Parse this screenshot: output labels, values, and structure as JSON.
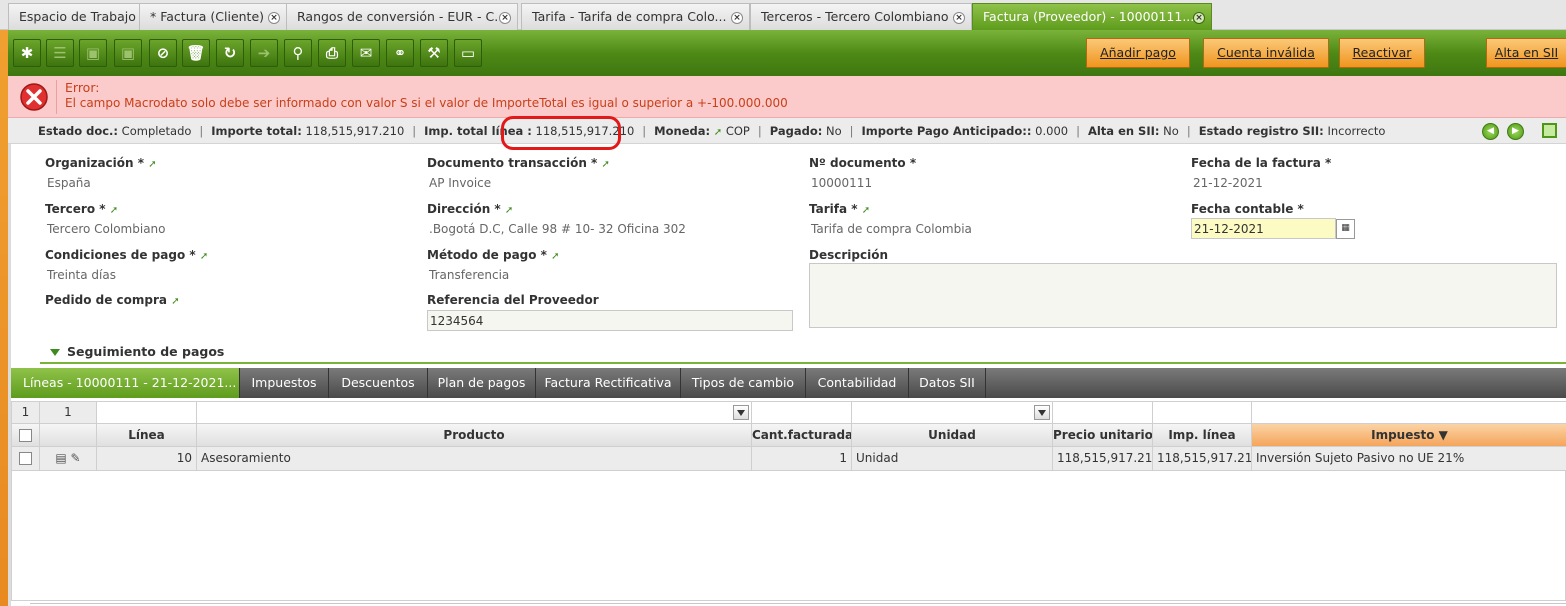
{
  "window_tabs": [
    {
      "label": "Espacio de Trabajo"
    },
    {
      "label": "* Factura (Cliente)"
    },
    {
      "label": "Rangos de conversión - EUR - C..."
    },
    {
      "label": "Tarifa - Tarifa de compra Colo..."
    },
    {
      "label": "Terceros - Tercero Colombiano"
    },
    {
      "label": "Factura (Proveedor) - 10000111..."
    }
  ],
  "toolbar": {
    "icons": [
      "new-document-icon",
      "grid-view-icon",
      "save-icon",
      "save-close-icon",
      "undo-icon",
      "delete-icon",
      "refresh-icon",
      "export-icon",
      "attachment-icon",
      "print-icon",
      "email-icon",
      "link-icon",
      "tools-icon",
      "form-view-icon"
    ],
    "buttons": {
      "add_payment": "Añadir pago",
      "invalid_account": "Cuenta inválida",
      "reactivate": "Reactivar",
      "sii_register": "Alta en SII"
    }
  },
  "error": {
    "title": "Error:",
    "message": "El campo Macrodato solo debe ser informado con valor S si el valor de ImporteTotal es igual o superior a +-100.000.000"
  },
  "status": {
    "doc_status_label": "Estado doc.:",
    "doc_status_value": "Completado",
    "total_label": "Importe total:",
    "total_value": "118,515,917.210",
    "line_total_label": "Imp. total línea :",
    "line_total_value": "118,515,917.210",
    "currency_label": "Moneda:",
    "currency_value": "COP",
    "paid_label": "Pagado:",
    "paid_value": "No",
    "prepayment_label": "Importe Pago Anticipado::",
    "prepayment_value": "0.000",
    "sii_label": "Alta en SII:",
    "sii_value": "No",
    "sii_status_label": "Estado registro SII:",
    "sii_status_value": "Incorrecto",
    "sep": "|"
  },
  "form": {
    "organization_label": "Organización *",
    "organization_value": "España",
    "doc_transaction_label": "Documento transacción *",
    "doc_transaction_value": "AP Invoice",
    "doc_number_label": "Nº documento *",
    "doc_number_value": "10000111",
    "invoice_date_label": "Fecha de la factura *",
    "invoice_date_value": "21-12-2021",
    "third_party_label": "Tercero *",
    "third_party_value": "Tercero Colombiano",
    "address_label": "Dirección *",
    "address_value": ".Bogotá D.C, Calle 98 # 10- 32 Oficina 302",
    "pricelist_label": "Tarifa *",
    "pricelist_value": "Tarifa de compra Colombia",
    "accounting_date_label": "Fecha contable *",
    "accounting_date_value": "21-12-2021",
    "payment_terms_label": "Condiciones de pago *",
    "payment_terms_value": "Treinta días",
    "payment_method_label": "Método de pago *",
    "payment_method_value": "Transferencia",
    "description_label": "Descripción",
    "purchase_order_label": "Pedido de compra",
    "supplier_ref_label": "Referencia del Proveedor",
    "supplier_ref_value": "1234564"
  },
  "section": {
    "payments_tracking": "Seguimiento de pagos"
  },
  "detail_tabs": [
    {
      "label": "Líneas - 10000111 - 21-12-2021..."
    },
    {
      "label": "Impuestos"
    },
    {
      "label": "Descuentos"
    },
    {
      "label": "Plan de pagos"
    },
    {
      "label": "Factura Rectificativa"
    },
    {
      "label": "Tipos de cambio"
    },
    {
      "label": "Contabilidad"
    },
    {
      "label": "Datos SII"
    }
  ],
  "grid": {
    "selected_count": "1",
    "total_count": "1",
    "headers": {
      "line": "Línea",
      "product": "Producto",
      "qty_invoiced": "Cant.facturada",
      "unit": "Unidad",
      "unit_price": "Precio unitario",
      "line_amount": "Imp. línea",
      "tax": "Impuesto ▼"
    },
    "rows": [
      {
        "line": "10",
        "product": "Asesoramiento",
        "qty": "1",
        "unit": "Unidad",
        "unit_price": "118,515,917.210",
        "line_amount": "118,515,917.210",
        "tax": "Inversión Sujeto Pasivo no UE 21%"
      }
    ]
  },
  "colors": {
    "accent_green": "#5e9c1c",
    "action_orange": "#f0951e",
    "error_bg": "#fbcaca",
    "error_text": "#c8401a",
    "highlight_red": "#e31818"
  }
}
